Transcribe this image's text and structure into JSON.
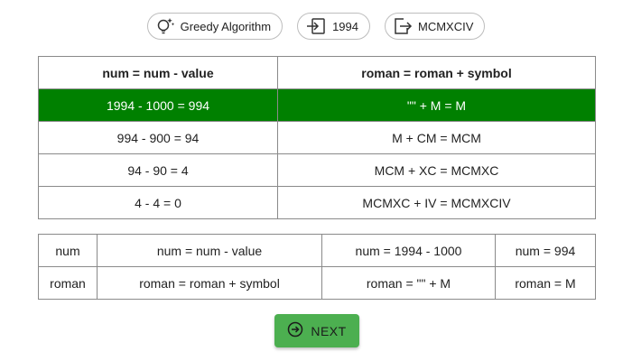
{
  "chips": {
    "algorithm": "Greedy Algorithm",
    "input": "1994",
    "output": "MCMXCIV"
  },
  "steps_table": {
    "headers": [
      "num = num - value",
      "roman = roman + symbol"
    ],
    "rows": [
      [
        "1994 - 1000 = 994",
        "\"\" + M = M"
      ],
      [
        "994 - 900 = 94",
        "M + CM = MCM"
      ],
      [
        "94 - 90 = 4",
        "MCM + XC = MCMXC"
      ],
      [
        "4 - 4 = 0",
        "MCMXC + IV = MCMXCIV"
      ]
    ],
    "highlight_color": "#008000"
  },
  "state_table": {
    "rows": [
      [
        "num",
        "num = num - value",
        "num = 1994 - 1000",
        "num = 994"
      ],
      [
        "roman",
        "roman = roman + symbol",
        "roman = \"\" + M",
        "roman = M"
      ]
    ]
  },
  "next_button": {
    "label": "NEXT",
    "icon": "arrow-circle-right-icon",
    "color": "#4caf50"
  }
}
